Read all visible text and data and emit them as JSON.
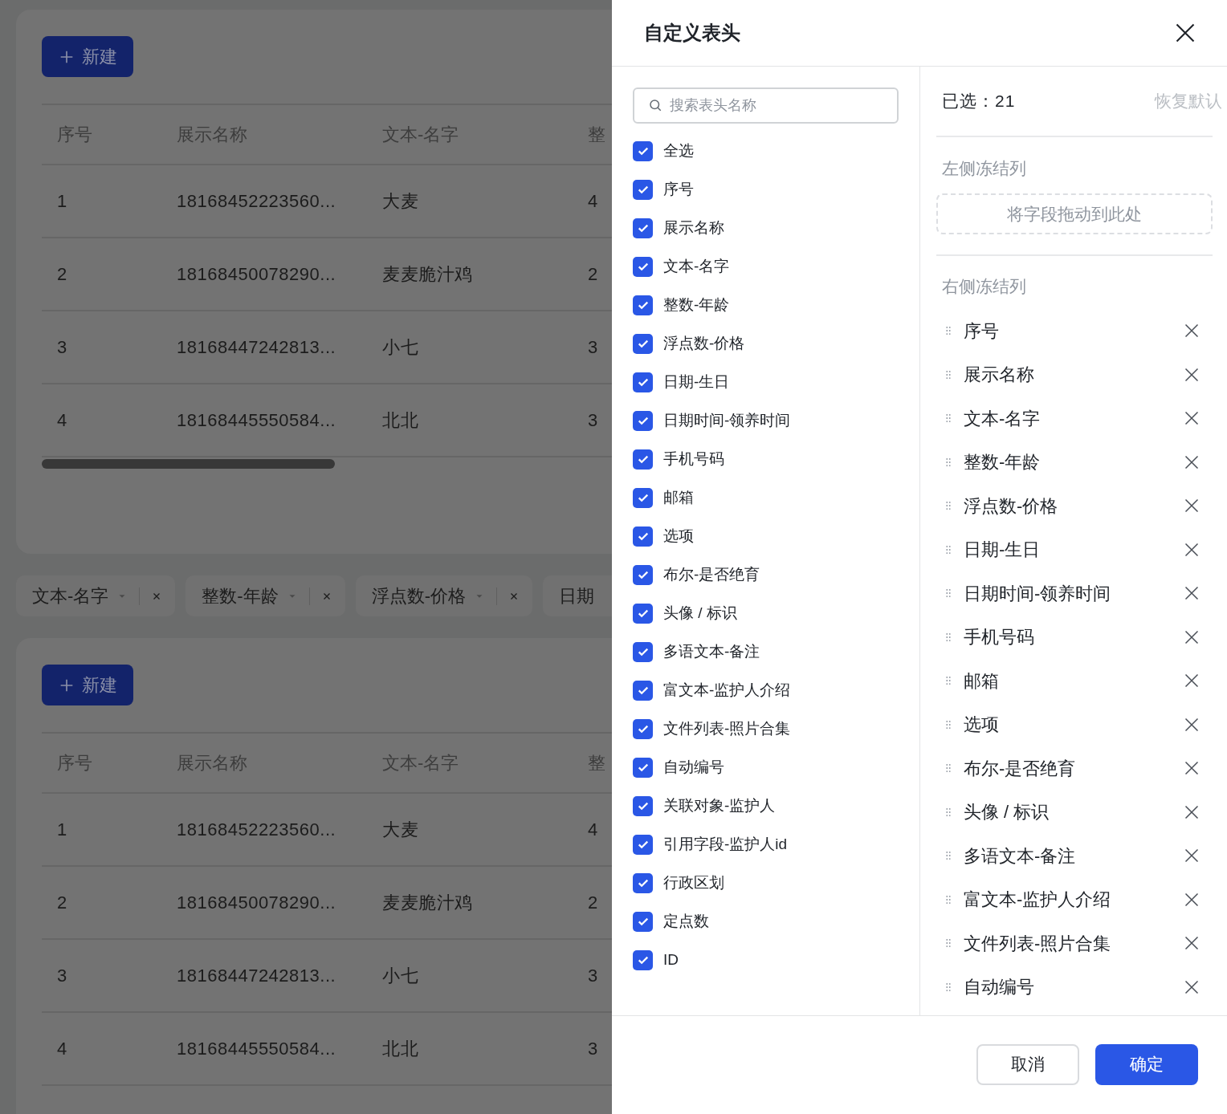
{
  "background": {
    "tables": [
      {
        "new_button": "新建",
        "columns": [
          "序号",
          "展示名称",
          "文本-名字",
          "整"
        ],
        "rows": [
          [
            "1",
            "18168452223560...",
            "大麦",
            "4"
          ],
          [
            "2",
            "18168450078290...",
            "麦麦脆汁鸡",
            "2"
          ],
          [
            "3",
            "18168447242813...",
            "小七",
            "3"
          ],
          [
            "4",
            "18168445550584...",
            "北北",
            "3"
          ]
        ],
        "scrollbar": true
      },
      {
        "new_button": "新建",
        "columns": [
          "序号",
          "展示名称",
          "文本-名字",
          "整"
        ],
        "rows": [
          [
            "1",
            "18168452223560...",
            "大麦",
            "4"
          ],
          [
            "2",
            "18168450078290...",
            "麦麦脆汁鸡",
            "2"
          ],
          [
            "3",
            "18168447242813...",
            "小七",
            "3"
          ],
          [
            "4",
            "18168445550584...",
            "北北",
            "3"
          ]
        ],
        "scrollbar": false
      }
    ],
    "filter_chips": [
      {
        "label": "文本-名字",
        "removable": true
      },
      {
        "label": "整数-年龄",
        "removable": true
      },
      {
        "label": "浮点数-价格",
        "removable": true
      },
      {
        "label": "日期",
        "removable": false
      }
    ]
  },
  "drawer": {
    "title": "自定义表头",
    "search": {
      "placeholder": "搜索表头名称"
    },
    "columns": [
      {
        "label": "全选",
        "checked": true
      },
      {
        "label": "序号",
        "checked": true
      },
      {
        "label": "展示名称",
        "checked": true
      },
      {
        "label": "文本-名字",
        "checked": true
      },
      {
        "label": "整数-年龄",
        "checked": true
      },
      {
        "label": "浮点数-价格",
        "checked": true
      },
      {
        "label": "日期-生日",
        "checked": true
      },
      {
        "label": "日期时间-领养时间",
        "checked": true
      },
      {
        "label": "手机号码",
        "checked": true
      },
      {
        "label": "邮箱",
        "checked": true
      },
      {
        "label": "选项",
        "checked": true
      },
      {
        "label": "布尔-是否绝育",
        "checked": true
      },
      {
        "label": "头像 / 标识",
        "checked": true
      },
      {
        "label": "多语文本-备注",
        "checked": true
      },
      {
        "label": "富文本-监护人介绍",
        "checked": true
      },
      {
        "label": "文件列表-照片合集",
        "checked": true
      },
      {
        "label": "自动编号",
        "checked": true
      },
      {
        "label": "关联对象-监护人",
        "checked": true
      },
      {
        "label": "引用字段-监护人id",
        "checked": true
      },
      {
        "label": "行政区划",
        "checked": true
      },
      {
        "label": "定点数",
        "checked": true
      },
      {
        "label": "ID",
        "checked": true
      }
    ],
    "selected_count": "已选：21",
    "reset_link": "恢复默认",
    "left_frozen": {
      "title": "左侧冻结列",
      "drop_hint": "将字段拖动到此处"
    },
    "right_frozen": {
      "title": "右侧冻结列",
      "items": [
        "序号",
        "展示名称",
        "文本-名字",
        "整数-年龄",
        "浮点数-价格",
        "日期-生日",
        "日期时间-领养时间",
        "手机号码",
        "邮箱",
        "选项",
        "布尔-是否绝育",
        "头像 / 标识",
        "多语文本-备注",
        "富文本-监护人介绍",
        "文件列表-照片合集",
        "自动编号"
      ]
    },
    "buttons": {
      "cancel": "取消",
      "confirm": "确定"
    }
  }
}
